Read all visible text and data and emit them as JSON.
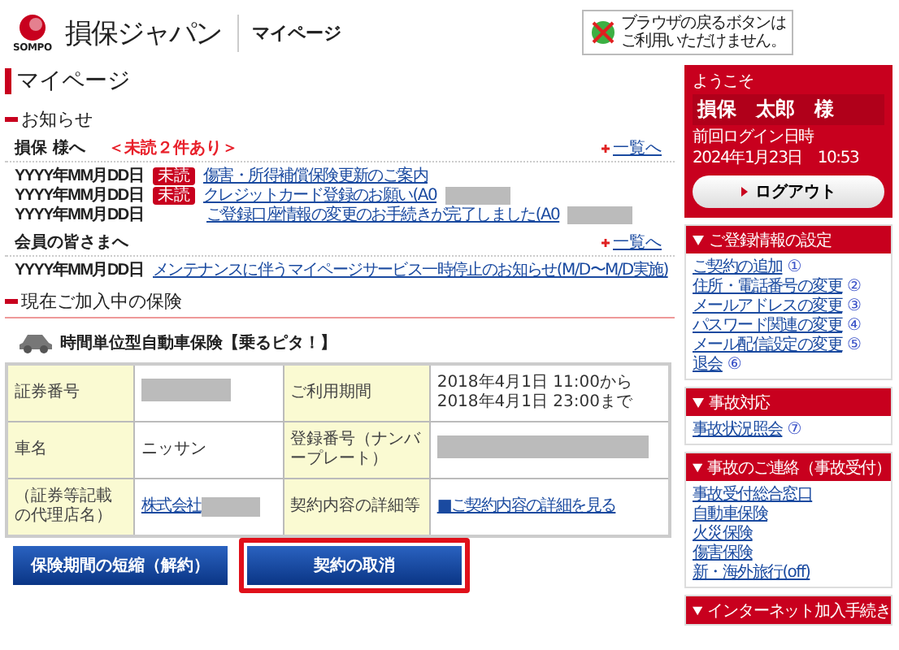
{
  "header": {
    "brand": "損保ジャパン",
    "brand_sub": "SOMPO",
    "section": "マイページ",
    "notice_lines": [
      "ブラウザの戻るボタンは",
      "ご利用いただけません。"
    ]
  },
  "page_title": "マイページ",
  "news": {
    "heading": "お知らせ",
    "groups": [
      {
        "title": "損保 様へ",
        "unread": "＜未読２件あり＞",
        "more": "一覧へ",
        "items": [
          {
            "date": "YYYY年MM月DD日",
            "badge": "未読",
            "text": "傷害・所得補償保険更新のご案内"
          },
          {
            "date": "YYYY年MM月DD日",
            "badge": "未読",
            "text": "クレジットカード登録のお願い(A0",
            "redacted": true
          },
          {
            "date": "YYYY年MM月DD日",
            "text": "ご登録口座情報の変更のお手続きが完了しました(A0",
            "redacted": true
          }
        ]
      },
      {
        "title": "会員の皆さまへ",
        "more": "一覧へ",
        "items": [
          {
            "date": "YYYY年MM月DD日",
            "text": "メンテナンスに伴うマイページサービス一時停止のお知らせ(M/D〜M/D実施)"
          }
        ]
      }
    ]
  },
  "current": {
    "heading": "現在ご加入中の保険",
    "product": "時間単位型自動車保険【乗るピタ！】",
    "rows": [
      [
        {
          "kind": "label",
          "text": "証券番号"
        },
        {
          "kind": "redacted"
        },
        {
          "kind": "label",
          "text": "ご利用期間"
        },
        {
          "kind": "text",
          "text": "2018年4月1日 11:00から\n2018年4月1日 23:00まで"
        }
      ],
      [
        {
          "kind": "label",
          "text": "車名"
        },
        {
          "kind": "text",
          "text": "ニッサン"
        },
        {
          "kind": "label",
          "text": "登録番号（ナンバープレート）"
        },
        {
          "kind": "redacted"
        }
      ],
      [
        {
          "kind": "label",
          "text": "（証券等記載の代理店名）"
        },
        {
          "kind": "link",
          "text": "株式会社",
          "redacted": true
        },
        {
          "kind": "label",
          "text": "契約内容の詳細等"
        },
        {
          "kind": "link",
          "text": "■ご契約内容の詳細を見る"
        }
      ]
    ],
    "buttons": [
      {
        "label": "保険期間の短縮（解約）",
        "highlighted": false
      },
      {
        "label": "契約の取消",
        "highlighted": true
      }
    ]
  },
  "sidebar": {
    "welcome": {
      "greeting": "ようこそ",
      "name": "損保　太郎　様",
      "login_label": "前回ログイン日時",
      "login_time": "2024年1月23日　10:53",
      "logout": "ログアウト"
    },
    "sections": [
      {
        "title": "ご登録情報の設定",
        "links": [
          {
            "text": "ご契約の追加",
            "number": "①"
          },
          {
            "text": "住所・電話番号の変更",
            "number": "②"
          },
          {
            "text": "メールアドレスの変更",
            "number": "③"
          },
          {
            "text": "パスワード関連の変更",
            "number": "④"
          },
          {
            "text": "メール配信設定の変更",
            "number": "⑤"
          },
          {
            "text": "退会",
            "number": "⑥"
          }
        ]
      },
      {
        "title": "事故対応",
        "links": [
          {
            "text": "事故状況照会",
            "number": "⑦"
          }
        ]
      },
      {
        "title": "事故のご連絡（事故受付）",
        "links": [
          {
            "text": "事故受付総合窓口"
          },
          {
            "text": "自動車保険"
          },
          {
            "text": "火災保険"
          },
          {
            "text": "傷害保険"
          },
          {
            "text": "新・海外旅行(off)"
          }
        ]
      },
      {
        "title": "インターネット加入手続き"
      }
    ]
  }
}
